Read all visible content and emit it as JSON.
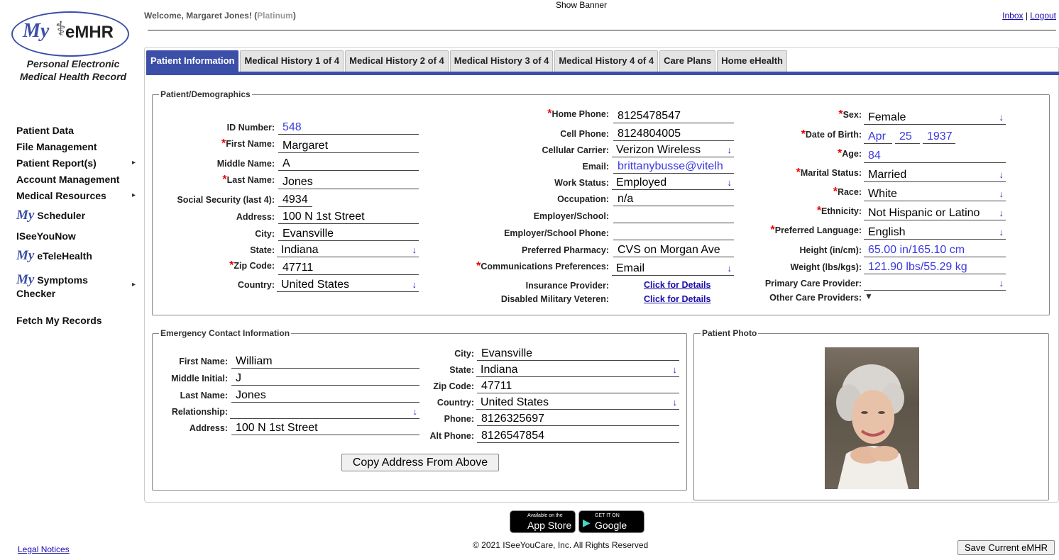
{
  "logo": {
    "my": "My",
    "emhr": "eMHR",
    "subtitle_line1": "Personal Electronic",
    "subtitle_line2": "Medical Health Record"
  },
  "nav": {
    "items": [
      {
        "label": "Patient Data"
      },
      {
        "label": "File Management"
      },
      {
        "label": "Patient Report(s)"
      },
      {
        "label": "Account Management"
      },
      {
        "label": "Medical Resources"
      },
      {
        "my": "My",
        "label": "Scheduler"
      },
      {
        "label": "ISeeYouNow"
      },
      {
        "my": "My",
        "label": "eTeleHealth"
      },
      {
        "my": "My",
        "label": "Symptoms",
        "label2": "Checker"
      },
      {
        "label": "Fetch My Records"
      }
    ],
    "legal": "Legal Notices"
  },
  "header": {
    "show_banner": "Show Banner",
    "welcome": "Welcome, Margaret Jones! (",
    "level": "Platinum",
    "welcome_end": ")",
    "inbox": "Inbox",
    "sep": " | ",
    "logout": "Logout"
  },
  "tabs": [
    {
      "label": "Patient Information",
      "active": true
    },
    {
      "label": "Medical History 1 of 4"
    },
    {
      "label": "Medical History 2 of 4"
    },
    {
      "label": "Medical History 3 of 4"
    },
    {
      "label": "Medical History 4 of 4"
    },
    {
      "label": "Care Plans"
    },
    {
      "label": "Home eHealth"
    }
  ],
  "demographics": {
    "legend": "Patient/Demographics",
    "id_number": {
      "label": "ID Number:",
      "value": "548"
    },
    "first_name": {
      "label": "First Name:",
      "value": "Margaret"
    },
    "middle_name": {
      "label": "Middle Name:",
      "value": "A"
    },
    "last_name": {
      "label": "Last Name:",
      "value": "Jones"
    },
    "ssn": {
      "label": "Social Security (last 4):",
      "value": "4934"
    },
    "address": {
      "label": "Address:",
      "value": "100 N 1st Street"
    },
    "city": {
      "label": "City:",
      "value": "Evansville"
    },
    "state": {
      "label": "State:",
      "value": "Indiana"
    },
    "zip": {
      "label": "Zip Code:",
      "value": "47711"
    },
    "country": {
      "label": "Country:",
      "value": "United States"
    },
    "home_phone": {
      "label": "Home Phone:",
      "value": "8125478547"
    },
    "cell_phone": {
      "label": "Cell Phone:",
      "value": "8124804005"
    },
    "carrier": {
      "label": "Cellular Carrier:",
      "value": "Verizon Wireless"
    },
    "email": {
      "label": "Email:",
      "value": "brittanybusse@vitelh"
    },
    "work_status": {
      "label": "Work Status:",
      "value": "Employed"
    },
    "occupation": {
      "label": "Occupation:",
      "value": "n/a"
    },
    "employer": {
      "label": "Employer/School:",
      "value": ""
    },
    "employer_phone": {
      "label": "Employer/School Phone:",
      "value": ""
    },
    "pharmacy": {
      "label": "Preferred Pharmacy:",
      "value": "CVS on Morgan Ave"
    },
    "comm_pref": {
      "label": "Communications Preferences:",
      "value": "Email"
    },
    "insurance": {
      "label": "Insurance Provider:",
      "link": "Click for Details"
    },
    "military": {
      "label": "Disabled Military Veteren:",
      "link": "Click for Details"
    },
    "sex": {
      "label": "Sex:",
      "value": "Female"
    },
    "dob": {
      "label": "Date of Birth:",
      "month": "Apr",
      "day": "25",
      "year": "1937"
    },
    "age": {
      "label": "Age:",
      "value": "84"
    },
    "marital": {
      "label": "Marital Status:",
      "value": "Married"
    },
    "race": {
      "label": "Race:",
      "value": "White"
    },
    "ethnicity": {
      "label": "Ethnicity:",
      "value": "Not Hispanic or Latino"
    },
    "language": {
      "label": "Preferred Language:",
      "value": "English"
    },
    "height": {
      "label": "Height (in/cm):",
      "value": "65.00 in/165.10 cm"
    },
    "weight": {
      "label": "Weight (lbs/kgs):",
      "value": "121.90 lbs/55.29 kg"
    },
    "pcp": {
      "label": "Primary Care Provider:",
      "value": ""
    },
    "other_providers": {
      "label": "Other Care Providers:"
    }
  },
  "emergency": {
    "legend": "Emergency Contact Information",
    "first_name": {
      "label": "First Name:",
      "value": "William"
    },
    "middle_initial": {
      "label": "Middle Initial:",
      "value": "J"
    },
    "last_name": {
      "label": "Last Name:",
      "value": "Jones"
    },
    "relationship": {
      "label": "Relationship:",
      "value": ""
    },
    "address": {
      "label": "Address:",
      "value": "100 N 1st Street"
    },
    "city": {
      "label": "City:",
      "value": "Evansville"
    },
    "state": {
      "label": "State:",
      "value": "Indiana"
    },
    "zip": {
      "label": "Zip Code:",
      "value": "47711"
    },
    "country": {
      "label": "Country:",
      "value": "United States"
    },
    "phone": {
      "label": "Phone:",
      "value": "8126325697"
    },
    "alt_phone": {
      "label": "Alt Phone:",
      "value": "8126547854"
    },
    "copy_button": "Copy Address From Above"
  },
  "photo": {
    "legend": "Patient Photo"
  },
  "footer": {
    "appstore_small": "Available on the",
    "appstore_big": "App Store",
    "gplay_small": "GET IT ON",
    "gplay_big": "Google play",
    "copyright": "© 2021 ISeeYouCare, Inc. All Rights Reserved",
    "save_button": "Save Current eMHR"
  },
  "colors": {
    "brand_blue": "#3b4fa8",
    "required_red": "#e00000",
    "value_blue": "#3a3ade",
    "link_blue": "#1a0dab"
  }
}
